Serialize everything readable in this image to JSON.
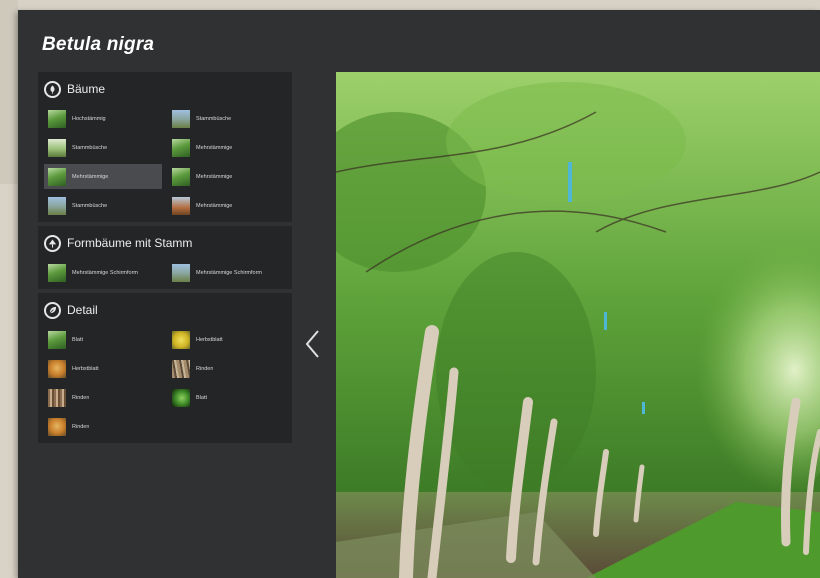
{
  "app": {
    "title": "Betula nigra"
  },
  "sidebar": {
    "groups": [
      {
        "title": "Bäume",
        "icon": "tree-leaf-icon",
        "items": [
          {
            "label": "Hochstämmig",
            "thumb": "green"
          },
          {
            "label": "Stammbüsche",
            "thumb": "sky"
          },
          {
            "label": "Stammbüsche",
            "thumb": "light"
          },
          {
            "label": "Mehrstämmige",
            "thumb": "green"
          },
          {
            "label": "Mehrstämmige",
            "thumb": "green",
            "selected": true
          },
          {
            "label": "Mehrstämmige",
            "thumb": "green"
          },
          {
            "label": "Stammbüsche",
            "thumb": "sky"
          },
          {
            "label": "Mehrstämmige",
            "thumb": "dusk"
          }
        ]
      },
      {
        "title": "Formbäume mit Stamm",
        "icon": "shaped-tree-icon",
        "items": [
          {
            "label": "Mehrstämmige Schirmform",
            "thumb": "green"
          },
          {
            "label": "Mehrstämmige Schirmform",
            "thumb": "sky"
          }
        ]
      },
      {
        "title": "Detail",
        "icon": "leaf-detail-icon",
        "items": [
          {
            "label": "Blatt",
            "thumb": "green"
          },
          {
            "label": "Herbstblatt",
            "thumb": "yellow"
          },
          {
            "label": "Herbstblatt",
            "thumb": "orange"
          },
          {
            "label": "Rinden",
            "thumb": "bark2"
          },
          {
            "label": "Rinden",
            "thumb": "bark"
          },
          {
            "label": "Blatt",
            "thumb": "leafdark"
          },
          {
            "label": "Rinden",
            "thumb": "orange"
          }
        ]
      }
    ]
  },
  "viewer": {
    "prev_icon": "chevron-left-icon"
  },
  "colors": {
    "window": "#303133",
    "panel": "#242527",
    "selected": "#4a4b4e"
  }
}
